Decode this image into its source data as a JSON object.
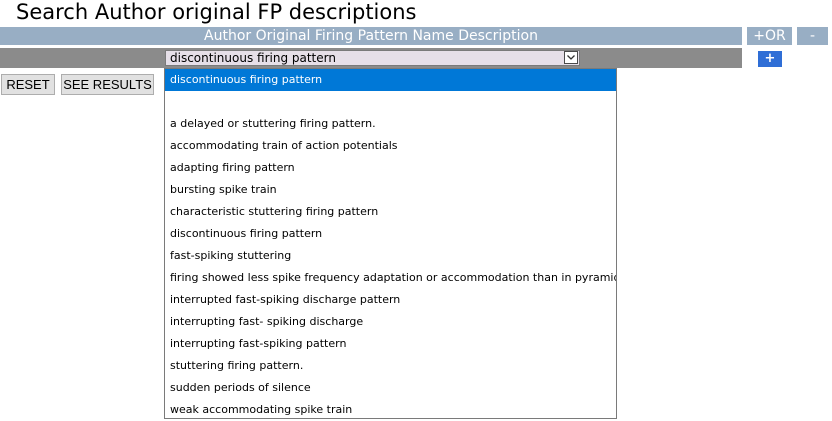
{
  "page": {
    "title": "Search Author original FP descriptions"
  },
  "header": {
    "label": "Author Original Firing Pattern Name Description",
    "or_label": "+OR",
    "minus_label": "-"
  },
  "select": {
    "value": "discontinuous firing pattern",
    "options": [
      "discontinuous firing pattern",
      "",
      "a delayed or stuttering firing pattern.",
      "accommodating train of action potentials",
      "adapting firing pattern",
      "bursting spike train",
      "characteristic stuttering firing pattern",
      "discontinuous firing pattern",
      "fast-spiking stuttering",
      "firing showed less spike frequency adaptation or accommodation than in pyramidal cells",
      "interrupted fast-spiking discharge pattern",
      "interrupting fast- spiking discharge",
      "interrupting fast-spiking pattern",
      "stuttering firing pattern.",
      "sudden periods of silence",
      "weak accommodating spike train"
    ]
  },
  "actions": {
    "plus_label": "+",
    "reset_label": "RESET",
    "see_results_label": "SEE RESULTS"
  },
  "colors": {
    "header_bg": "#98aec4",
    "row_bg": "#8b8b8b",
    "plus_bg": "#2f6ed6",
    "selected_option_bg": "#0078d7"
  },
  "icons": {
    "select_arrow": "chevron-down-icon"
  }
}
